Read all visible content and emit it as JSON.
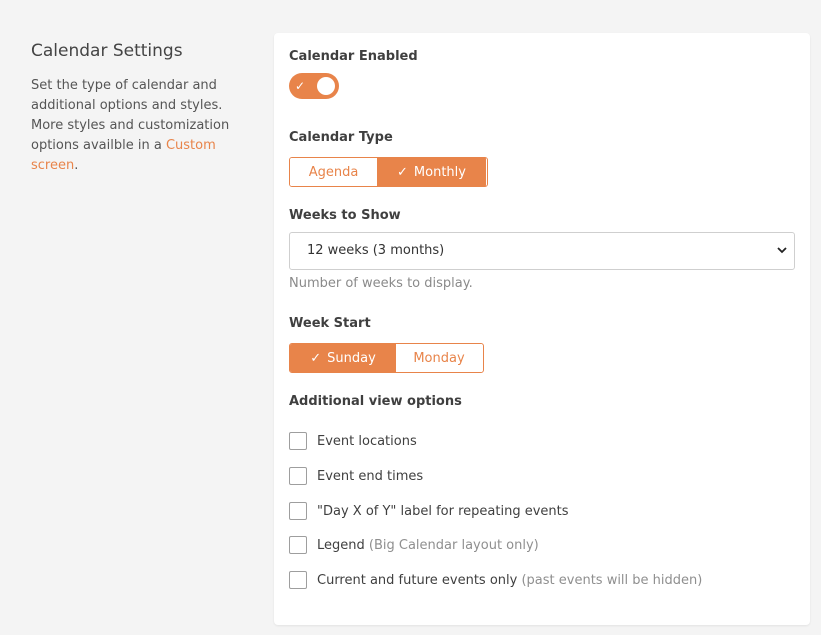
{
  "sidebar": {
    "title": "Calendar Settings",
    "description": "Set the type of calendar and additional options and styles. More styles and customization options availble in a ",
    "link_text": "Custom screen",
    "description_end": "."
  },
  "calendar_enabled": {
    "label": "Calendar Enabled",
    "on": true
  },
  "calendar_type": {
    "label": "Calendar Type",
    "options": [
      "Agenda",
      "Monthly"
    ],
    "selected": "Monthly"
  },
  "weeks_to_show": {
    "label": "Weeks to Show",
    "value": "12 weeks (3 months)",
    "help": "Number of weeks to display."
  },
  "week_start": {
    "label": "Week Start",
    "options": [
      "Sunday",
      "Monday"
    ],
    "selected": "Sunday"
  },
  "additional": {
    "label": "Additional view options",
    "items": [
      {
        "label": "Event locations",
        "note": "",
        "checked": false
      },
      {
        "label": "Event end times",
        "note": "",
        "checked": false
      },
      {
        "label": "\"Day X of Y\" label for repeating events",
        "note": "",
        "checked": false
      },
      {
        "label": "Legend",
        "note": "(Big Calendar layout only)",
        "checked": false
      },
      {
        "label": "Current and future events only",
        "note": "(past events will be hidden)",
        "checked": false
      }
    ]
  },
  "colors": {
    "accent": "#e8844a",
    "background": "#f4f4f4"
  }
}
